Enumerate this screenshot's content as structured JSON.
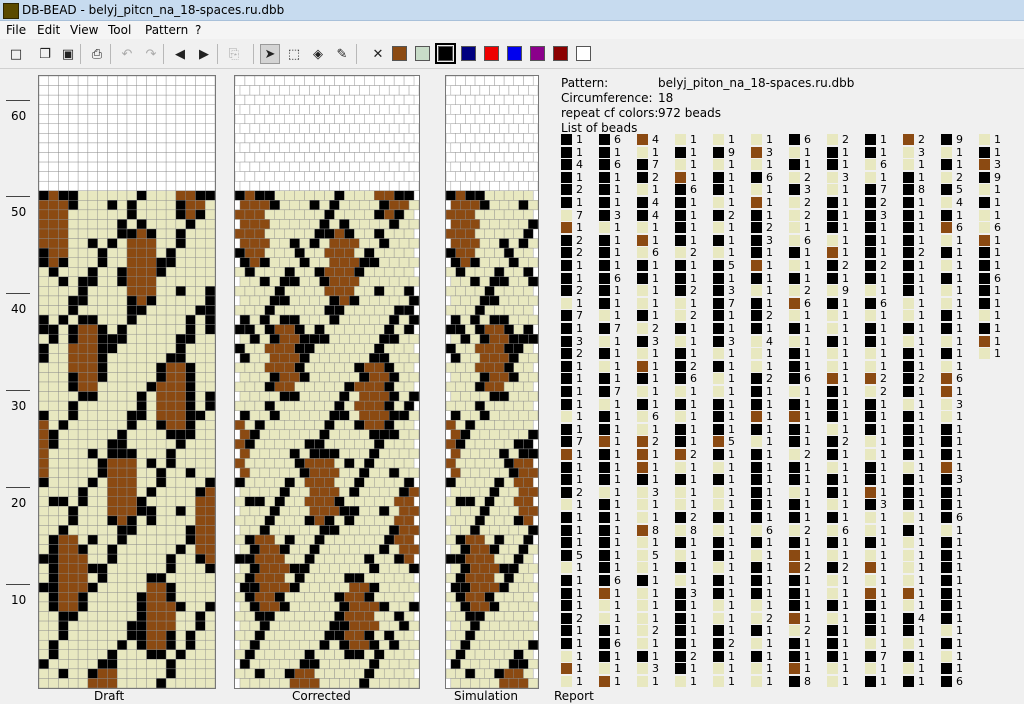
{
  "window": {
    "title": "DB-BEAD - belyj_pitcn_na_18-spaces.ru.dbb"
  },
  "menu": [
    {
      "label": "File"
    },
    {
      "label": "Edit"
    },
    {
      "label": "View"
    },
    {
      "label": "Tool"
    },
    {
      "label": "Pattern"
    },
    {
      "label": "?"
    }
  ],
  "toolbar": {
    "tools": [
      {
        "name": "new-file-icon",
        "glyph": "□",
        "enabled": true
      },
      {
        "name": "open-folder-icon",
        "glyph": "❐",
        "enabled": true
      },
      {
        "name": "save-icon",
        "glyph": "▣",
        "enabled": true
      },
      {
        "name": "print-icon",
        "glyph": "⎙",
        "enabled": true
      },
      {
        "name": "undo-icon",
        "glyph": "↶",
        "enabled": false
      },
      {
        "name": "redo-icon",
        "glyph": "↷",
        "enabled": false
      },
      {
        "name": "shift-left-icon",
        "glyph": "◀",
        "enabled": true
      },
      {
        "name": "shift-right-icon",
        "glyph": "▶",
        "enabled": true
      },
      {
        "name": "paste-icon",
        "glyph": "⎘",
        "enabled": false
      },
      {
        "name": "pointer-tool-icon",
        "glyph": "➤",
        "enabled": true,
        "selected": true
      },
      {
        "name": "select-rect-icon",
        "glyph": "⬚",
        "enabled": true
      },
      {
        "name": "fill-bucket-icon",
        "glyph": "◈",
        "enabled": true
      },
      {
        "name": "color-picker-icon",
        "glyph": "✎",
        "enabled": true
      },
      {
        "name": "delete-color-icon",
        "glyph": "✕",
        "enabled": true
      }
    ],
    "palette": [
      "#8b4a12",
      "#c8dcc8",
      "#000000",
      "#000080",
      "#ee0000",
      "#0000ee",
      "#8b008b",
      "#8b0000",
      "#ffffff"
    ],
    "selected_palette_index": 2
  },
  "colors": {
    "bg": "#ffffff",
    "cream": "#e8e8c0",
    "black": "#000000",
    "brown": "#8b4a12"
  },
  "ruler": {
    "labels": [
      "60",
      "50",
      "40",
      "30",
      "20",
      "10"
    ]
  },
  "panes": {
    "draft": "Draft",
    "corrected": "Corrected",
    "simulation": "Simulation",
    "report": "Report"
  },
  "info": {
    "pattern_label": "Pattern:",
    "pattern_value": "belyj_piton_na_18-spaces.ru.dbb",
    "circumference_label": "Circumference:",
    "circumference_value": "18",
    "repeat_label": "repeat cf colors:",
    "repeat_value": "972 beads",
    "list_label": "List of beads"
  },
  "report_columns": [
    {
      "colors": [
        3,
        3,
        3,
        3,
        3,
        3,
        1,
        2,
        3,
        3,
        3,
        3,
        3,
        1,
        3,
        3,
        3,
        3,
        3,
        3,
        3,
        3,
        1,
        3,
        3,
        2,
        3,
        3,
        3,
        1,
        3,
        3,
        3,
        3,
        1,
        3,
        3,
        3,
        3,
        3,
        3,
        1,
        2,
        1
      ],
      "counts": [
        "1",
        "1",
        "4",
        "1",
        "2",
        "1",
        "7",
        "1",
        "2",
        "2",
        "1",
        "1",
        "2",
        "1",
        "7",
        "1",
        "3",
        "2",
        "1",
        "1",
        "1",
        "1",
        "1",
        "1",
        "7",
        "1",
        "1",
        "1",
        "2",
        "1",
        "1",
        "1",
        "1",
        "5",
        "1",
        "1",
        "1",
        "1",
        "2",
        "1",
        "1",
        "1",
        "1",
        "1"
      ]
    },
    {
      "colors": [
        3,
        3,
        3,
        3,
        3,
        3,
        3,
        1,
        3,
        3,
        3,
        3,
        3,
        3,
        1,
        3,
        1,
        3,
        1,
        3,
        3,
        1,
        3,
        3,
        2,
        3,
        3,
        3,
        1,
        3,
        3,
        3,
        3,
        3,
        3,
        3,
        2,
        1,
        1,
        3,
        3,
        3,
        1,
        2
      ],
      "counts": [
        "6",
        "1",
        "6",
        "1",
        "1",
        "1",
        "3",
        "1",
        "1",
        "1",
        "1",
        "6",
        "1",
        "1",
        "1",
        "7",
        "1",
        "1",
        "1",
        "1",
        "7",
        "1",
        "1",
        "1",
        "1",
        "1",
        "1",
        "1",
        "1",
        "1",
        "1",
        "1",
        "1",
        "1",
        "1",
        "6",
        "1",
        "1",
        "1",
        "1",
        "6",
        "1",
        "1",
        "1"
      ]
    },
    {
      "colors": [
        2,
        1,
        3,
        3,
        1,
        3,
        3,
        1,
        2,
        1,
        3,
        3,
        1,
        1,
        3,
        1,
        3,
        1,
        2,
        3,
        1,
        3,
        1,
        1,
        2,
        2,
        2,
        3,
        1,
        1,
        1,
        2,
        1,
        1,
        1,
        3,
        1,
        1,
        1,
        1,
        1,
        3,
        1,
        1
      ],
      "counts": [
        "4",
        "1",
        "7",
        "2",
        "1",
        "4",
        "4",
        "1",
        "1",
        "6",
        "1",
        "1",
        "1",
        "1",
        "1",
        "2",
        "3",
        "1",
        "1",
        "1",
        "1",
        "1",
        "6",
        "1",
        "2",
        "1",
        "1",
        "1",
        "3",
        "1",
        "1",
        "8",
        "1",
        "5",
        "1",
        "1",
        "1",
        "1",
        "1",
        "2",
        "1",
        "1",
        "3",
        "1"
      ]
    },
    {
      "colors": [
        1,
        3,
        1,
        2,
        3,
        3,
        3,
        3,
        3,
        1,
        3,
        3,
        3,
        1,
        1,
        3,
        1,
        3,
        3,
        3,
        1,
        3,
        1,
        3,
        3,
        2,
        1,
        3,
        1,
        1,
        3,
        1,
        3,
        1,
        3,
        1,
        3,
        3,
        3,
        3,
        3,
        3,
        3,
        1
      ],
      "counts": [
        "1",
        "1",
        "1",
        "1",
        "6",
        "1",
        "1",
        "1",
        "1",
        "2",
        "1",
        "1",
        "2",
        "1",
        "2",
        "1",
        "1",
        "1",
        "2",
        "6",
        "1",
        "1",
        "1",
        "1",
        "1",
        "2",
        "1",
        "1",
        "1",
        "1",
        "2",
        "8",
        "1",
        "1",
        "1",
        "1",
        "3",
        "1",
        "1",
        "1",
        "1",
        "2",
        "1",
        "1"
      ]
    },
    {
      "colors": [
        1,
        3,
        1,
        3,
        3,
        1,
        3,
        1,
        3,
        1,
        3,
        3,
        3,
        3,
        3,
        3,
        3,
        1,
        3,
        1,
        1,
        3,
        3,
        3,
        2,
        3,
        1,
        3,
        1,
        1,
        3,
        1,
        3,
        3,
        1,
        3,
        3,
        1,
        1,
        3,
        3,
        3,
        1,
        1
      ],
      "counts": [
        "1",
        "9",
        "1",
        "1",
        "1",
        "1",
        "2",
        "1",
        "1",
        "1",
        "5",
        "1",
        "3",
        "7",
        "1",
        "1",
        "3",
        "1",
        "1",
        "1",
        "1",
        "1",
        "1",
        "1",
        "5",
        "1",
        "1",
        "1",
        "1",
        "1",
        "1",
        "1",
        "1",
        "1",
        "1",
        "1",
        "1",
        "1",
        "1",
        "1",
        "2",
        "1",
        "1",
        "1"
      ]
    },
    {
      "colors": [
        1,
        2,
        1,
        3,
        1,
        2,
        3,
        3,
        3,
        3,
        2,
        3,
        1,
        3,
        3,
        3,
        1,
        1,
        1,
        3,
        3,
        3,
        2,
        3,
        1,
        3,
        3,
        3,
        3,
        3,
        3,
        1,
        3,
        1,
        3,
        3,
        3,
        1,
        1,
        3,
        1,
        3,
        1,
        1
      ],
      "counts": [
        "1",
        "3",
        "1",
        "6",
        "1",
        "1",
        "1",
        "2",
        "3",
        "1",
        "1",
        "1",
        "1",
        "1",
        "2",
        "1",
        "4",
        "1",
        "1",
        "2",
        "1",
        "1",
        "1",
        "1",
        "1",
        "1",
        "1",
        "1",
        "1",
        "1",
        "1",
        "6",
        "1",
        "1",
        "1",
        "1",
        "1",
        "1",
        "2",
        "1",
        "1",
        "1",
        "1",
        "1"
      ]
    },
    {
      "colors": [
        3,
        1,
        3,
        1,
        3,
        1,
        1,
        1,
        1,
        3,
        1,
        3,
        1,
        2,
        1,
        3,
        1,
        3,
        3,
        3,
        1,
        3,
        2,
        3,
        3,
        1,
        3,
        3,
        1,
        3,
        3,
        1,
        3,
        2,
        2,
        3,
        3,
        3,
        2,
        1,
        3,
        3,
        2,
        3
      ],
      "counts": [
        "6",
        "1",
        "1",
        "2",
        "3",
        "2",
        "2",
        "1",
        "6",
        "1",
        "1",
        "1",
        "2",
        "6",
        "1",
        "1",
        "1",
        "1",
        "1",
        "6",
        "1",
        "1",
        "1",
        "1",
        "1",
        "2",
        "1",
        "1",
        "1",
        "1",
        "1",
        "2",
        "1",
        "1",
        "2",
        "1",
        "1",
        "1",
        "1",
        "2",
        "1",
        "1",
        "1",
        "8"
      ]
    },
    {
      "colors": [
        1,
        3,
        3,
        1,
        1,
        3,
        3,
        3,
        1,
        2,
        3,
        3,
        1,
        3,
        1,
        1,
        3,
        1,
        1,
        2,
        3,
        3,
        3,
        1,
        3,
        3,
        1,
        3,
        3,
        1,
        3,
        1,
        3,
        1,
        3,
        1,
        1,
        3,
        1,
        3,
        3,
        3,
        1,
        1
      ],
      "counts": [
        "2",
        "1",
        "1",
        "3",
        "1",
        "1",
        "1",
        "1",
        "1",
        "1",
        "2",
        "1",
        "9",
        "1",
        "1",
        "1",
        "1",
        "1",
        "1",
        "1",
        "1",
        "1",
        "1",
        "1",
        "2",
        "1",
        "1",
        "1",
        "1",
        "1",
        "1",
        "6",
        "1",
        "1",
        "2",
        "1",
        "1",
        "1",
        "1",
        "1",
        "1",
        "1",
        "1",
        "1"
      ]
    },
    {
      "colors": [
        3,
        3,
        1,
        1,
        3,
        3,
        3,
        3,
        3,
        3,
        3,
        3,
        1,
        3,
        1,
        3,
        3,
        1,
        1,
        2,
        1,
        3,
        3,
        3,
        1,
        1,
        3,
        3,
        2,
        3,
        1,
        1,
        3,
        1,
        2,
        1,
        2,
        3,
        3,
        3,
        1,
        3,
        1,
        3
      ],
      "counts": [
        "1",
        "1",
        "6",
        "1",
        "7",
        "2",
        "3",
        "1",
        "1",
        "1",
        "2",
        "1",
        "1",
        "6",
        "1",
        "1",
        "1",
        "1",
        "1",
        "2",
        "2",
        "1",
        "1",
        "1",
        "1",
        "1",
        "1",
        "1",
        "1",
        "3",
        "1",
        "1",
        "1",
        "1",
        "1",
        "1",
        "1",
        "1",
        "1",
        "1",
        "1",
        "7",
        "1",
        "1"
      ]
    },
    {
      "colors": [
        2,
        1,
        1,
        3,
        3,
        3,
        3,
        3,
        3,
        3,
        3,
        3,
        3,
        1,
        1,
        3,
        1,
        3,
        3,
        3,
        3,
        1,
        3,
        3,
        3,
        3,
        1,
        3,
        3,
        3,
        1,
        3,
        1,
        1,
        1,
        1,
        2,
        1,
        3,
        3,
        1,
        3,
        1,
        3
      ],
      "counts": [
        "2",
        "3",
        "1",
        "1",
        "8",
        "1",
        "1",
        "1",
        "1",
        "2",
        "1",
        "1",
        "1",
        "1",
        "1",
        "1",
        "1",
        "1",
        "1",
        "2",
        "1",
        "1",
        "1",
        "1",
        "1",
        "1",
        "1",
        "1",
        "1",
        "1",
        "1",
        "1",
        "1",
        "1",
        "1",
        "1",
        "1",
        "1",
        "4",
        "1",
        "1",
        "1",
        "1",
        "1"
      ]
    },
    {
      "colors": [
        3,
        1,
        3,
        1,
        3,
        1,
        3,
        2,
        1,
        3,
        1,
        3,
        1,
        1,
        3,
        3,
        1,
        3,
        1,
        2,
        2,
        1,
        1,
        3,
        3,
        3,
        2,
        3,
        3,
        3,
        3,
        1,
        3,
        3,
        3,
        3,
        3,
        3,
        3,
        1,
        3,
        1,
        3,
        3
      ],
      "counts": [
        "9",
        "1",
        "1",
        "2",
        "5",
        "4",
        "1",
        "6",
        "1",
        "1",
        "1",
        "1",
        "1",
        "1",
        "1",
        "1",
        "1",
        "1",
        "1",
        "6",
        "1",
        "3",
        "1",
        "1",
        "1",
        "1",
        "1",
        "3",
        "1",
        "1",
        "6",
        "1",
        "1",
        "1",
        "1",
        "1",
        "1",
        "1",
        "1",
        "1",
        "1",
        "1",
        "1",
        "6"
      ]
    },
    {
      "colors": [
        1,
        3,
        2,
        3,
        1,
        3,
        1,
        1,
        2,
        3,
        3,
        3,
        3,
        3,
        1,
        3,
        2,
        1
      ],
      "counts": [
        "1",
        "1",
        "3",
        "9",
        "1",
        "1",
        "1",
        "6",
        "1",
        "1",
        "1",
        "6",
        "1",
        "1",
        "1",
        "1",
        "1",
        "1"
      ]
    }
  ]
}
